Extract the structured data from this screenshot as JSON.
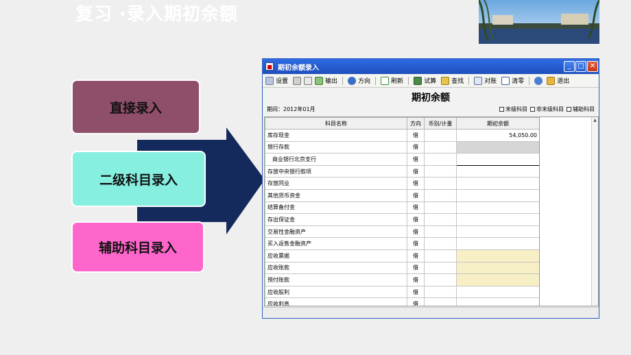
{
  "slide": {
    "title": "复习 ·录入期初余额"
  },
  "labels": {
    "direct": "直接录入",
    "secondary": "二级科目录入",
    "auxiliary": "辅助科目录入"
  },
  "window": {
    "title": "期初余额录入",
    "toolbar": [
      "设置",
      "输出",
      "方向",
      "刷新",
      "试算",
      "查找",
      "对账",
      "清零",
      "退出"
    ],
    "form_title": "期初余额",
    "period": "期间：2012年01月",
    "filters": [
      "末级科目",
      "非末级科目",
      "辅助科目"
    ],
    "columns": [
      "科目名称",
      "方向",
      "币别/计量",
      "期初余额"
    ],
    "rows": [
      {
        "name": "库存现金",
        "dir": "借",
        "cur": "",
        "amount": "54,050.00",
        "style": ""
      },
      {
        "name": "银行存款",
        "dir": "借",
        "cur": "",
        "amount": "",
        "style": "gray"
      },
      {
        "name": "商业银行北京支行",
        "dir": "借",
        "cur": "",
        "amount": "",
        "style": "editing",
        "indent": true
      },
      {
        "name": "存放中央银行款项",
        "dir": "借",
        "cur": "",
        "amount": "",
        "style": ""
      },
      {
        "name": "存放同业",
        "dir": "借",
        "cur": "",
        "amount": "",
        "style": ""
      },
      {
        "name": "其他货币资金",
        "dir": "借",
        "cur": "",
        "amount": "",
        "style": ""
      },
      {
        "name": "结算备付金",
        "dir": "借",
        "cur": "",
        "amount": "",
        "style": ""
      },
      {
        "name": "存出保证金",
        "dir": "借",
        "cur": "",
        "amount": "",
        "style": ""
      },
      {
        "name": "交易性金融资产",
        "dir": "借",
        "cur": "",
        "amount": "",
        "style": ""
      },
      {
        "name": "买入返售金融资产",
        "dir": "借",
        "cur": "",
        "amount": "",
        "style": ""
      },
      {
        "name": "应收票据",
        "dir": "借",
        "cur": "",
        "amount": "",
        "style": "yellow"
      },
      {
        "name": "应收账款",
        "dir": "借",
        "cur": "",
        "amount": "",
        "style": "yellow"
      },
      {
        "name": "预付账款",
        "dir": "借",
        "cur": "",
        "amount": "",
        "style": "yellow"
      },
      {
        "name": "应收股利",
        "dir": "借",
        "cur": "",
        "amount": "",
        "style": ""
      },
      {
        "name": "应收利息",
        "dir": "借",
        "cur": "",
        "amount": "",
        "style": ""
      }
    ]
  },
  "colors": {
    "box1": "#8f4f6b",
    "box2": "#86efe0",
    "box3": "#ff66cc",
    "arrow": "#142a5c",
    "titlebar": "#2e6be3"
  }
}
